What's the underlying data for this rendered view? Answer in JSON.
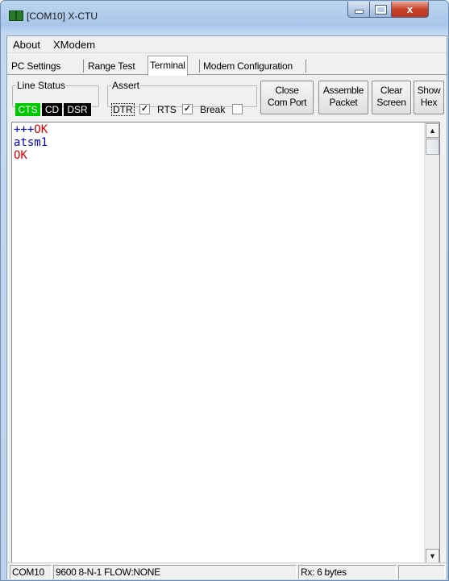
{
  "window": {
    "title": "[COM10] X-CTU",
    "close_glyph": "x"
  },
  "menu": {
    "items": [
      "About",
      "XModem"
    ]
  },
  "tabs": [
    "PC Settings",
    "Range Test",
    "Terminal",
    "Modem Configuration"
  ],
  "active_tab": "Terminal",
  "line_status": {
    "legend": "Line Status",
    "cts": "CTS",
    "cd": "CD",
    "dsr": "DSR",
    "cts_color": "#00c800",
    "cd_color": "#000000",
    "dsr_color": "#000000"
  },
  "assert": {
    "legend": "Assert",
    "dtr": {
      "label": "DTR",
      "checked": true
    },
    "rts": {
      "label": "RTS",
      "checked": true
    },
    "break": {
      "label": "Break",
      "checked": false
    }
  },
  "buttons": {
    "close_com_port": [
      "Close",
      "Com Port"
    ],
    "assemble_packet": [
      "Assemble",
      "Packet"
    ],
    "clear_screen": [
      "Clear",
      "Screen"
    ],
    "show_hex": [
      "Show",
      "Hex"
    ]
  },
  "terminal": {
    "lines": [
      [
        {
          "text": "+++",
          "color": "#0000d0"
        },
        {
          "text": "OK",
          "color": "#e00000"
        }
      ],
      [
        {
          "text": "atsm1",
          "color": "#0000d0"
        }
      ],
      [
        {
          "text": "OK",
          "color": "#e00000"
        }
      ]
    ],
    "sent_color": "#0000d0",
    "received_color": "#e00000"
  },
  "statusbar": {
    "port": "COM10",
    "settings": "9600 8-N-1  FLOW:NONE",
    "rx": "Rx: 6 bytes"
  },
  "icons": {
    "app": "app-icon",
    "minimize": "minimize-icon",
    "maximize": "maximize-icon",
    "close": "close-icon",
    "scroll_up": "scroll-up-arrow-icon",
    "scroll_down": "scroll-down-arrow-icon"
  }
}
